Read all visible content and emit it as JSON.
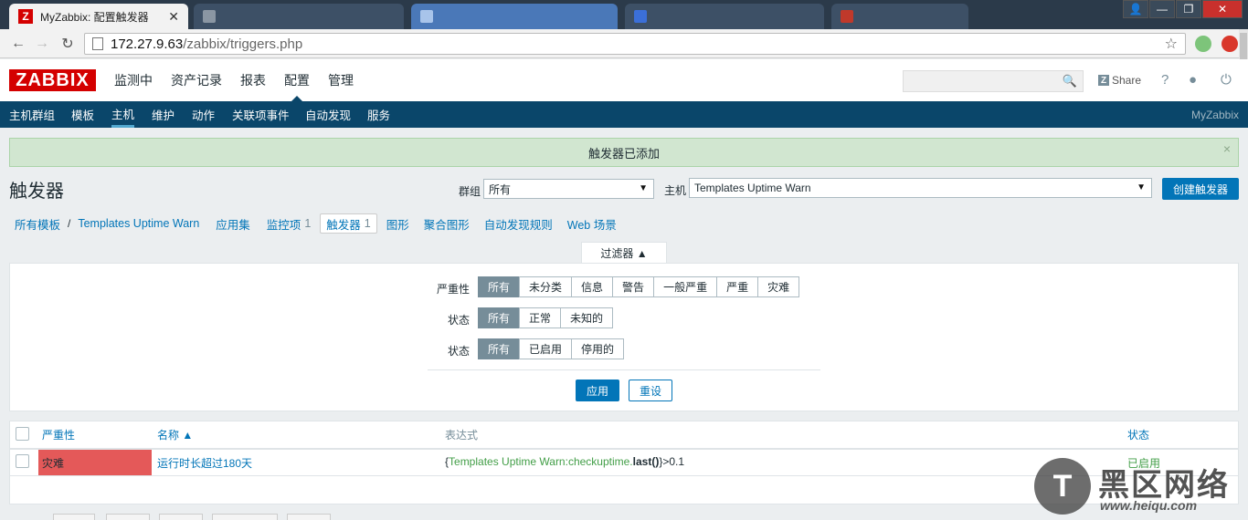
{
  "browser": {
    "active_tab_title": "MyZabbix: 配置触发器",
    "background_tabs": [
      "",
      "",
      "",
      ""
    ],
    "url_host": "172.27.9.63",
    "url_path": "/zabbix/triggers.php"
  },
  "header": {
    "logo": "ZABBIX",
    "menu": [
      "监测中",
      "资产记录",
      "报表",
      "配置",
      "管理"
    ],
    "selected_menu": "配置",
    "share_label": "Share",
    "help_icon": "?"
  },
  "submenu": {
    "items": [
      "主机群组",
      "模板",
      "主机",
      "维护",
      "动作",
      "关联项事件",
      "自动发现",
      "服务"
    ],
    "selected": "主机",
    "right_label": "MyZabbix"
  },
  "message": {
    "text": "触发器已添加",
    "close": "×"
  },
  "page": {
    "title": "触发器",
    "group_label": "群组",
    "group_value": "所有",
    "host_label": "主机",
    "host_value": "Templates Uptime Warn",
    "create_button": "创建触发器"
  },
  "breadcrumbs": {
    "all_templates": "所有模板",
    "separator": "/",
    "template": "Templates Uptime Warn",
    "applications": "应用集",
    "items": "监控项",
    "items_count": "1",
    "triggers": "触发器",
    "triggers_count": "1",
    "graphs": "图形",
    "screens": "聚合图形",
    "discovery": "自动发现规则",
    "web": "Web 场景"
  },
  "filter": {
    "tab_label": "过滤器 ▲",
    "severity_label": "严重性",
    "severity_options": [
      "所有",
      "未分类",
      "信息",
      "警告",
      "一般严重",
      "严重",
      "灾难"
    ],
    "state_label": "状态",
    "state_options": [
      "所有",
      "正常",
      "未知的"
    ],
    "status_label": "状态",
    "status_options": [
      "所有",
      "已启用",
      "停用的"
    ],
    "apply_button": "应用",
    "reset_button": "重设"
  },
  "table": {
    "columns": [
      "严重性",
      "名称 ▲",
      "表达式",
      "状态"
    ],
    "rows": [
      {
        "severity": "灾难",
        "name": "运行时长超过180天",
        "expr_open": "{",
        "expr_key": "Templates Uptime Warn:checkuptime.",
        "expr_func": "last()",
        "expr_close": "}",
        "expr_tail": ">0.1",
        "status": "已启用"
      }
    ]
  },
  "watermark": {
    "logo_glyph": "T",
    "text": "黑区网络",
    "url": "www.heiqu.com"
  },
  "colors": {
    "brand_red": "#d40000",
    "nav_blue": "#0a466a",
    "link_blue": "#0275b8",
    "disaster_red": "#e45959",
    "enabled_green": "#429e47",
    "success_bg": "#d1e6d0"
  }
}
